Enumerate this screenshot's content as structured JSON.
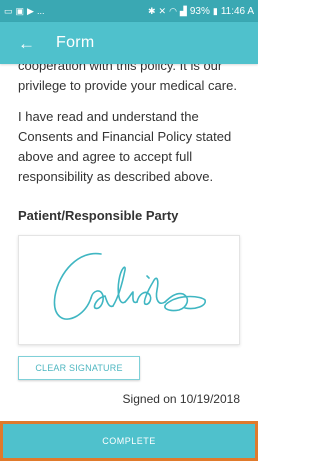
{
  "status_bar": {
    "battery": "93%",
    "time": "11:46 A",
    "left_icons": [
      "image-icon",
      "gallery-icon",
      "play-icon",
      "more-icon"
    ],
    "right_icons": [
      "bluetooth-icon",
      "mute-icon",
      "wifi-icon",
      "signal-icon",
      "battery-icon"
    ],
    "more": "..."
  },
  "app_bar": {
    "title": "Form",
    "back_icon": "back-arrow-icon"
  },
  "content": {
    "paragraph_1": "cooperation with this policy. It is our privilege to provide your medical care.",
    "paragraph_2": "I have read and understand the Consents and Financial Policy stated above and agree to accept full responsibility as described above.",
    "party_label": "Patient/Responsible Party",
    "clear_button": "CLEAR SIGNATURE",
    "signed_text": "Signed on 10/19/2018"
  },
  "footer": {
    "complete_button": "COMPLETE"
  },
  "colors": {
    "status_bar": "#3aa8b3",
    "app_bar": "#4fc1cc",
    "accent": "#4fc1cc",
    "signature_ink": "#3fb6c2",
    "footer_border": "#e07a2c"
  }
}
